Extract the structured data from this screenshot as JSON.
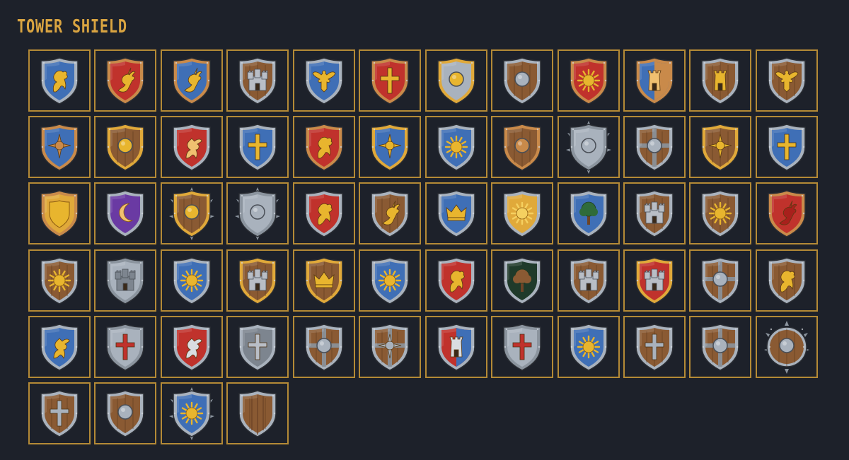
{
  "title": "TOWER SHIELD",
  "colors": {
    "background": "#1d212a",
    "frame": "#b48a36",
    "title": "#d9a441"
  },
  "shields": [
    {
      "field": "#3f6fb6",
      "trim": "#a9b2bd",
      "emblem": "lion",
      "emblemColor": "#e8b52e"
    },
    {
      "field": "#c0322c",
      "trim": "#c98a4a",
      "emblem": "dragon",
      "emblemColor": "#e8b52e"
    },
    {
      "field": "#3f6fb6",
      "trim": "#c98a4a",
      "emblem": "dragon",
      "emblemColor": "#e8b52e"
    },
    {
      "field": "#8a5a33",
      "trim": "#a9b2bd",
      "emblem": "castle",
      "emblemColor": "#b9bec6",
      "wood": true
    },
    {
      "field": "#3f6fb6",
      "trim": "#a9b2bd",
      "emblem": "eagle",
      "emblemColor": "#e8b52e"
    },
    {
      "field": "#c0322c",
      "trim": "#c98a4a",
      "emblem": "cross",
      "emblemColor": "#e8b52e"
    },
    {
      "field": "#a9b2bd",
      "trim": "#e0a93a",
      "emblem": "boss",
      "emblemColor": "#e8b52e"
    },
    {
      "field": "#8a5a33",
      "trim": "#a9b2bd",
      "emblem": "boss",
      "emblemColor": "#a9b2bd",
      "wood": true
    },
    {
      "field": "#c0322c",
      "trim": "#c98a4a",
      "emblem": "sun",
      "emblemColor": "#e8b52e"
    },
    {
      "field": "#3f6fb6",
      "trim": "#c98a4a",
      "emblem": "tower",
      "emblemColor": "#f0c070",
      "split": "#c98a4a"
    },
    {
      "field": "#8a5a33",
      "trim": "#a9b2bd",
      "emblem": "tower",
      "emblemColor": "#e8b52e",
      "wood": true
    },
    {
      "field": "#8a5a33",
      "trim": "#a9b2bd",
      "emblem": "eagle",
      "emblemColor": "#e8b52e",
      "wood": true
    },
    {
      "field": "#3f6fb6",
      "trim": "#c98a4a",
      "emblem": "star",
      "emblemColor": "#c98a4a"
    },
    {
      "field": "#8a5a33",
      "trim": "#e0a93a",
      "emblem": "boss",
      "emblemColor": "#e8b52e",
      "wood": true
    },
    {
      "field": "#c0322c",
      "trim": "#a9b2bd",
      "emblem": "griffin",
      "emblemColor": "#f0c070"
    },
    {
      "field": "#3f6fb6",
      "trim": "#a9b2bd",
      "emblem": "cross",
      "emblemColor": "#e8b52e"
    },
    {
      "field": "#c0322c",
      "trim": "#c98a4a",
      "emblem": "lion",
      "emblemColor": "#e8b52e"
    },
    {
      "field": "#3f6fb6",
      "trim": "#e0a93a",
      "emblem": "star",
      "emblemColor": "#e8b52e"
    },
    {
      "field": "#3f6fb6",
      "trim": "#a9b2bd",
      "emblem": "sun",
      "emblemColor": "#e8b52e"
    },
    {
      "field": "#8a5a33",
      "trim": "#c98a4a",
      "emblem": "boss",
      "emblemColor": "#c98a4a",
      "wood": true
    },
    {
      "field": "#a9b2bd",
      "trim": "#8b949e",
      "emblem": "boss",
      "emblemColor": "#a9b2bd",
      "spikes": true
    },
    {
      "field": "#8a5a33",
      "trim": "#a9b2bd",
      "emblem": "boss",
      "emblemColor": "#a9b2bd",
      "wood": true,
      "bands": true
    },
    {
      "field": "#8a5a33",
      "trim": "#e0a93a",
      "emblem": "star",
      "emblemColor": "#e8b52e",
      "wood": true
    },
    {
      "field": "#3f6fb6",
      "trim": "#a9b2bd",
      "emblem": "cross",
      "emblemColor": "#e8b52e"
    },
    {
      "field": "#e0a93a",
      "trim": "#c98a4a",
      "emblem": "inner",
      "emblemColor": "#e8b52e"
    },
    {
      "field": "#6a3aa3",
      "trim": "#a9b2bd",
      "emblem": "moon",
      "emblemColor": "#f0c070"
    },
    {
      "field": "#8a5a33",
      "trim": "#e0a93a",
      "emblem": "boss",
      "emblemColor": "#e8b52e",
      "wood": true,
      "spikes": true
    },
    {
      "field": "#a9b2bd",
      "trim": "#8b949e",
      "emblem": "boss",
      "emblemColor": "#a9b2bd",
      "spikes": true
    },
    {
      "field": "#c0322c",
      "trim": "#a9b2bd",
      "emblem": "lion",
      "emblemColor": "#e8b52e"
    },
    {
      "field": "#8a5a33",
      "trim": "#a9b2bd",
      "emblem": "dragon",
      "emblemColor": "#e8b52e",
      "wood": true
    },
    {
      "field": "#3f6fb6",
      "trim": "#a9b2bd",
      "emblem": "crown",
      "emblemColor": "#e8b52e"
    },
    {
      "field": "#e0a93a",
      "trim": "#a9b2bd",
      "emblem": "sun",
      "emblemColor": "#f5d060"
    },
    {
      "field": "#3f6fb6",
      "trim": "#a9b2bd",
      "emblem": "tree",
      "emblemColor": "#2f6b3a"
    },
    {
      "field": "#8a5a33",
      "trim": "#a9b2bd",
      "emblem": "castle",
      "emblemColor": "#b9bec6",
      "wood": true
    },
    {
      "field": "#8a5a33",
      "trim": "#a9b2bd",
      "emblem": "sun",
      "emblemColor": "#e8b52e",
      "wood": true
    },
    {
      "field": "#c0322c",
      "trim": "#c98a4a",
      "emblem": "dragon",
      "emblemColor": "#a8201c"
    },
    {
      "field": "#8a5a33",
      "trim": "#a9b2bd",
      "emblem": "sun",
      "emblemColor": "#e8b52e",
      "wood": true
    },
    {
      "field": "#a9b2bd",
      "trim": "#8b949e",
      "emblem": "castle",
      "emblemColor": "#7d858f"
    },
    {
      "field": "#3f6fb6",
      "trim": "#a9b2bd",
      "emblem": "sun",
      "emblemColor": "#e8b52e"
    },
    {
      "field": "#8a5a33",
      "trim": "#e0a93a",
      "emblem": "castle",
      "emblemColor": "#b9bec6",
      "wood": true
    },
    {
      "field": "#8a5a33",
      "trim": "#e0a93a",
      "emblem": "crown",
      "emblemColor": "#e8b52e",
      "wood": true
    },
    {
      "field": "#3f6fb6",
      "trim": "#a9b2bd",
      "emblem": "sun",
      "emblemColor": "#e8b52e"
    },
    {
      "field": "#c0322c",
      "trim": "#a9b2bd",
      "emblem": "lion",
      "emblemColor": "#e8b52e"
    },
    {
      "field": "#1f3a2a",
      "trim": "#a9b2bd",
      "emblem": "tree",
      "emblemColor": "#8a5a33"
    },
    {
      "field": "#8a5a33",
      "trim": "#a9b2bd",
      "emblem": "castle",
      "emblemColor": "#b9bec6",
      "wood": true
    },
    {
      "field": "#c0322c",
      "trim": "#e0a93a",
      "emblem": "castle",
      "emblemColor": "#b9bec6"
    },
    {
      "field": "#8a5a33",
      "trim": "#a9b2bd",
      "emblem": "boss",
      "emblemColor": "#a9b2bd",
      "wood": true,
      "bands": true
    },
    {
      "field": "#8a5a33",
      "trim": "#a9b2bd",
      "emblem": "lion",
      "emblemColor": "#e8b52e",
      "wood": true
    },
    {
      "field": "#3f6fb6",
      "trim": "#a9b2bd",
      "emblem": "griffin",
      "emblemColor": "#e8b52e"
    },
    {
      "field": "#a9b2bd",
      "trim": "#8b949e",
      "emblem": "cross",
      "emblemColor": "#c0322c"
    },
    {
      "field": "#c0322c",
      "trim": "#a9b2bd",
      "emblem": "griffin",
      "emblemColor": "#d9dde2"
    },
    {
      "field": "#7d858f",
      "trim": "#a9b2bd",
      "emblem": "cross",
      "emblemColor": "#b9bec6"
    },
    {
      "field": "#8a5a33",
      "trim": "#a9b2bd",
      "emblem": "boss",
      "emblemColor": "#a9b2bd",
      "wood": true,
      "bands": true
    },
    {
      "field": "#8a5a33",
      "trim": "#a9b2bd",
      "emblem": "star",
      "emblemColor": "#a9b2bd",
      "wood": true,
      "bands": true
    },
    {
      "field": "#c0322c",
      "trim": "#a9b2bd",
      "emblem": "tower",
      "emblemColor": "#d9dde2",
      "split": "#3f6fb6"
    },
    {
      "field": "#a9b2bd",
      "trim": "#8b949e",
      "emblem": "cross",
      "emblemColor": "#c0322c"
    },
    {
      "field": "#3f6fb6",
      "trim": "#a9b2bd",
      "emblem": "sun",
      "emblemColor": "#e8b52e"
    },
    {
      "field": "#8a5a33",
      "trim": "#a9b2bd",
      "emblem": "cross",
      "emblemColor": "#a9b2bd",
      "wood": true
    },
    {
      "field": "#8a5a33",
      "trim": "#a9b2bd",
      "emblem": "boss",
      "emblemColor": "#a9b2bd",
      "wood": true,
      "bands": true
    },
    {
      "field": "#8a5a33",
      "trim": "#a9b2bd",
      "emblem": "boss",
      "emblemColor": "#a9b2bd",
      "wood": true,
      "round": true,
      "spikes": true
    },
    {
      "field": "#8a5a33",
      "trim": "#a9b2bd",
      "emblem": "cross",
      "emblemColor": "#a9b2bd",
      "wood": true
    },
    {
      "field": "#8a5a33",
      "trim": "#a9b2bd",
      "emblem": "boss",
      "emblemColor": "#a9b2bd",
      "wood": true
    },
    {
      "field": "#3f6fb6",
      "trim": "#a9b2bd",
      "emblem": "sun",
      "emblemColor": "#e8b52e",
      "spikes": true
    },
    {
      "field": "#8a5a33",
      "trim": "#a9b2bd",
      "emblem": "planks",
      "emblemColor": "#6e4426",
      "wood": true
    }
  ]
}
